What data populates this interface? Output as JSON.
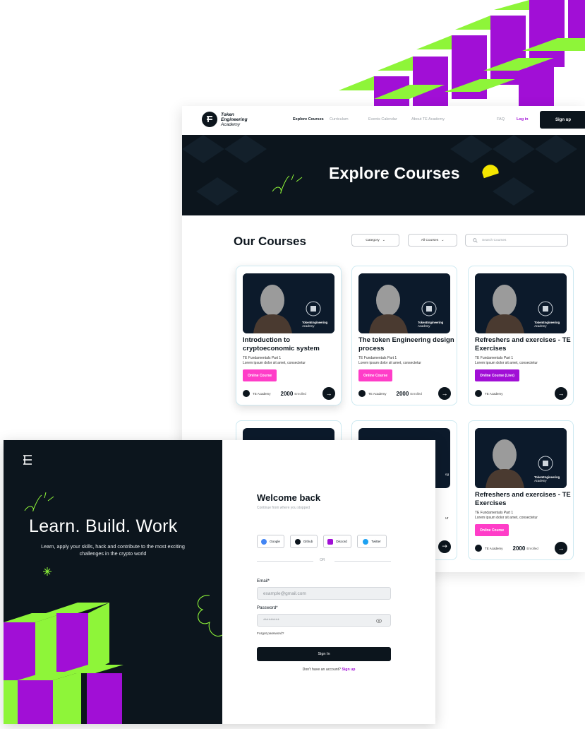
{
  "courses_page": {
    "logo_text": [
      "Token",
      "Engineering",
      "Academy"
    ],
    "nav": {
      "links": [
        "Explore Courses",
        "Curriculum",
        "Events Calendar",
        "About TE Academy"
      ],
      "faq": "FAQ",
      "login": "Log in",
      "signup": "Sign up"
    },
    "hero_title": "Explore Courses",
    "section_title": "Our Courses",
    "filters": {
      "category": "Category",
      "all_courses": "All Courses",
      "search_placeholder": "Search Courses"
    },
    "thumb_brand": [
      "TokenEngineering",
      "Academy"
    ],
    "cards": [
      {
        "title": "Introduction to cryptoeconomic system",
        "subtitle": "TE Fundamentals Part 1",
        "desc": "Lorem ipsum dolor sit amet, consectetur",
        "badge": "Online Course",
        "badge_color": "#ff3dc8",
        "org": "TE Academy",
        "enrolled": "2000",
        "enrolled_label": "Enrolled"
      },
      {
        "title": "The token Engineering design process",
        "subtitle": "TE Fundamentals Part 1",
        "desc": "Lorem ipsum dolor sit amet, consectetur",
        "badge": "Online Course",
        "badge_color": "#ff3dc8",
        "org": "TE Academy",
        "enrolled": "2000",
        "enrolled_label": "Enrolled"
      },
      {
        "title": "Refreshers and exercises - TE Exercises",
        "subtitle": "TE Fundamentals Part 1",
        "desc": "Lorem ipsum dolor sit amet, consectetur",
        "badge": "Online Course (Live)",
        "badge_color": "#a10fd6",
        "org": "TE Academy",
        "enrolled": "",
        "enrolled_label": ""
      },
      {
        "title": "Refreshers and exercises - TE Exercises",
        "subtitle": "TE Fundamentals Part 1",
        "desc": "Lorem ipsum dolor sit amet, consectetur",
        "badge": "Online Course",
        "badge_color": "#ff3dc8",
        "org": "TE Academy",
        "enrolled": "2000",
        "enrolled_label": "Enrolled"
      }
    ],
    "partial_card_text": {
      "ipsum_tail": "ur",
      "brand_tail": "ng"
    }
  },
  "login_page": {
    "headline": "Learn. Build. Work",
    "description": "Learn, apply your skills, hack and contribute to the most exciting challenges in the crypto world",
    "welcome": "Welcome back",
    "welcome_sub": "Continue from where you stopped",
    "social": [
      {
        "label": "Google",
        "icon": "google-icon",
        "color": "#4285f4"
      },
      {
        "label": "Github",
        "icon": "github-icon",
        "color": "#0c151d"
      },
      {
        "label": "Discord",
        "icon": "discord-icon",
        "color": "#a10fd6"
      },
      {
        "label": "Twitter",
        "icon": "twitter-icon",
        "color": "#1da1f2"
      }
    ],
    "or": "OR",
    "email_label": "Email*",
    "email_placeholder": "example@gmail.com",
    "password_label": "Password*",
    "password_value": "*********",
    "forgot": "Forgot password?",
    "signin": "Sign In",
    "no_account": "Don't have an account?",
    "signup_link": "Sign up"
  },
  "colors": {
    "dark": "#0c151d",
    "green": "#8ef539",
    "purple": "#a10fd6",
    "pink": "#ff3dc8",
    "yellow": "#f4e600"
  }
}
